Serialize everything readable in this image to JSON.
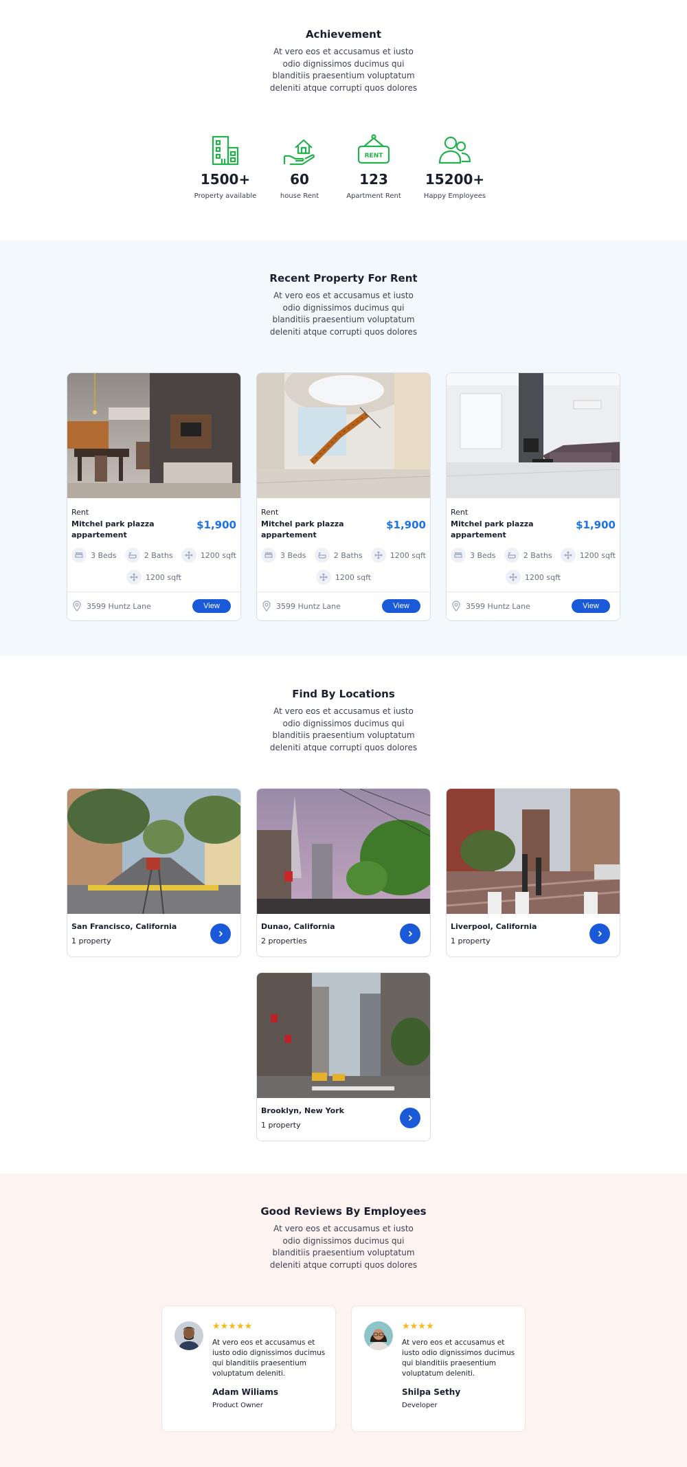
{
  "achievement": {
    "title": "Achievement",
    "description": "At vero eos et accusamus et iusto odio dignissimos ducimus qui blanditiis praesentium voluptatum deleniti atque corrupti quos dolores",
    "stats": [
      {
        "value": "1500+",
        "label": "Property available",
        "icon": "building-icon"
      },
      {
        "value": "60",
        "label": "house Rent",
        "icon": "house-hand-icon"
      },
      {
        "value": "123",
        "label": "Apartment Rent",
        "icon": "rent-sign-icon"
      },
      {
        "value": "15200+",
        "label": "Happy Employees",
        "icon": "people-icon"
      }
    ],
    "accent_color": "#22b14c"
  },
  "recent": {
    "title": "Recent Property For Rent",
    "description": "At vero eos et accusamus et iusto odio dignissimos ducimus qui blanditiis praesentium voluptatum deleniti atque corrupti quos dolores",
    "properties": [
      {
        "type": "Rent",
        "title": "Mitchel park plazza appartement",
        "price": "$1,900",
        "beds": "3 Beds",
        "baths": "2 Baths",
        "area": "1200 sqft",
        "area2": "1200 sqft",
        "address": "3599 Huntz Lane",
        "button": "View"
      },
      {
        "type": "Rent",
        "title": "Mitchel park plazza appartement",
        "price": "$1,900",
        "beds": "3 Beds",
        "baths": "2 Baths",
        "area": "1200 sqft",
        "area2": "1200 sqft",
        "address": "3599 Huntz Lane",
        "button": "View"
      },
      {
        "type": "Rent",
        "title": "Mitchel park plazza appartement",
        "price": "$1,900",
        "beds": "3 Beds",
        "baths": "2 Baths",
        "area": "1200 sqft",
        "area2": "1200 sqft",
        "address": "3599 Huntz Lane",
        "button": "View"
      }
    ],
    "price_color": "#1a73e8",
    "button_color": "#1a5ad8"
  },
  "locations": {
    "title": "Find By Locations",
    "description": "At vero eos et accusamus et iusto odio dignissimos ducimus qui blanditiis praesentium voluptatum deleniti atque corrupti quos dolores",
    "items": [
      {
        "name": "San Francisco, California",
        "count": "1 property"
      },
      {
        "name": "Dunao, California",
        "count": "2 properties"
      },
      {
        "name": "Liverpool, California",
        "count": "1 property"
      },
      {
        "name": "Brooklyn, New York",
        "count": "1 property"
      }
    ]
  },
  "reviews": {
    "title": "Good Reviews By Employees",
    "description": "At vero eos et accusamus et iusto odio dignissimos ducimus qui blanditiis praesentium voluptatum deleniti atque corrupti quos dolores",
    "items": [
      {
        "stars": "★★★★★",
        "rating": 5,
        "text": "At vero eos et accusamus et iusto odio dignissimos ducimus qui blanditiis praesentium voluptatum deleniti.",
        "name": "Adam Wiliams",
        "role": "Product Owner"
      },
      {
        "stars": "★★★★",
        "rating": 4,
        "text": "At vero eos et accusamus et iusto odio dignissimos ducimus qui blanditiis praesentium voluptatum deleniti.",
        "name": "Shilpa Sethy",
        "role": "Developer"
      }
    ],
    "star_color": "#f5b91e"
  }
}
